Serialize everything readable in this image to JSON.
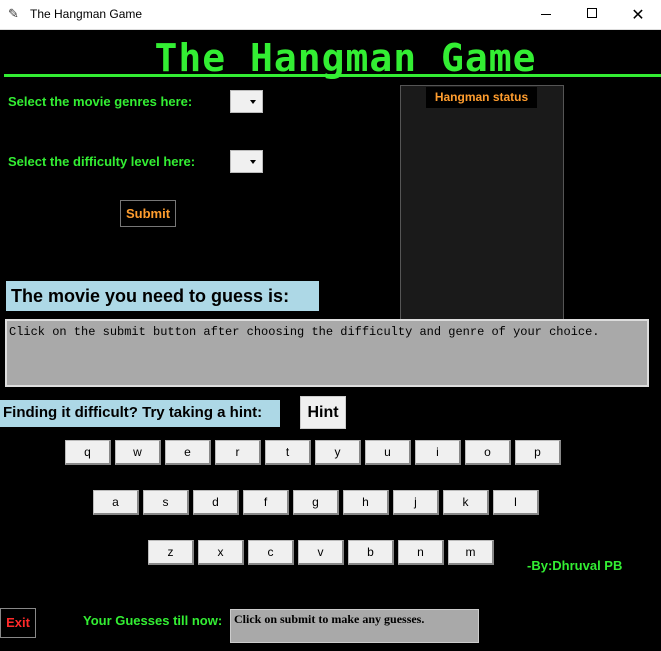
{
  "window": {
    "title": "The Hangman Game",
    "min_label": "—",
    "close_label": "✕"
  },
  "app": {
    "heading": "The Hangman Game",
    "genre_label": "Select the movie genres here:",
    "difficulty_label": "Select the difficulty level here:",
    "submit_label": "Submit",
    "status_label": "Hangman status",
    "guess_heading": "The movie you need to guess is:",
    "message": "Click on the submit button after choosing the difficulty and genre of your choice.",
    "hint_prompt": "Finding it difficult? Try taking a hint:",
    "hint_label": "Hint",
    "credit": "-By:Dhruval PB",
    "exit_label": "Exit",
    "guesses_label": "Your Guesses till now:",
    "guesses_value": "Click on submit to make any guesses."
  },
  "keyboard": {
    "row1": [
      "q",
      "w",
      "e",
      "r",
      "t",
      "y",
      "u",
      "i",
      "o",
      "p"
    ],
    "row2": [
      "a",
      "s",
      "d",
      "f",
      "g",
      "h",
      "j",
      "k",
      "l"
    ],
    "row3": [
      "z",
      "x",
      "c",
      "v",
      "b",
      "n",
      "m"
    ]
  },
  "colors": {
    "accent_green": "#33ee33",
    "accent_orange": "#ff9d2e",
    "exit_red": "#ff2a2a",
    "label_blue": "#add8e6",
    "box_gray": "#a9a9a9"
  }
}
